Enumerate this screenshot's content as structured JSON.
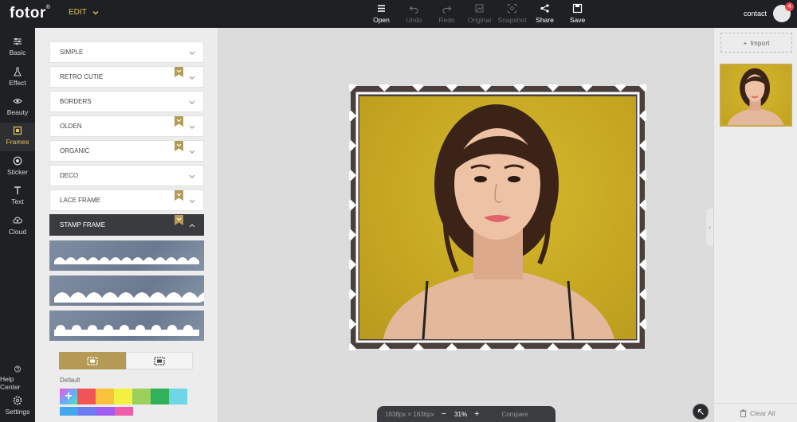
{
  "app": {
    "logo": "fotor",
    "logo_mark": "®",
    "edit_label": "EDIT"
  },
  "toolbar": [
    {
      "label": "Open",
      "icon": "menu-icon",
      "enabled": true
    },
    {
      "label": "Undo",
      "icon": "undo-icon",
      "enabled": false
    },
    {
      "label": "Redo",
      "icon": "redo-icon",
      "enabled": false
    },
    {
      "label": "Original",
      "icon": "original-icon",
      "enabled": false
    },
    {
      "label": "Snapshot",
      "icon": "snapshot-icon",
      "enabled": false
    },
    {
      "label": "Share",
      "icon": "share-icon",
      "enabled": true
    },
    {
      "label": "Save",
      "icon": "save-icon",
      "enabled": true
    }
  ],
  "account": {
    "label": "contact",
    "notifications": "4"
  },
  "nav": [
    {
      "label": "Basic",
      "icon": "sliders-icon"
    },
    {
      "label": "Effect",
      "icon": "flask-icon"
    },
    {
      "label": "Beauty",
      "icon": "eye-icon"
    },
    {
      "label": "Frames",
      "icon": "frame-icon",
      "active": true
    },
    {
      "label": "Sticker",
      "icon": "sticker-icon"
    },
    {
      "label": "Text",
      "icon": "text-icon"
    },
    {
      "label": "Cloud",
      "icon": "cloud-icon"
    },
    {
      "label": "Help Center",
      "icon": "help-icon"
    },
    {
      "label": "Settings",
      "icon": "settings-icon"
    }
  ],
  "frames": {
    "categories": [
      {
        "label": "SIMPLE",
        "premium": false
      },
      {
        "label": "RETRO CUTIE",
        "premium": true
      },
      {
        "label": "BORDERS",
        "premium": false
      },
      {
        "label": "OLDEN",
        "premium": true
      },
      {
        "label": "ORGANIC",
        "premium": true
      },
      {
        "label": "DECO",
        "premium": false
      },
      {
        "label": "LACE FRAME",
        "premium": true
      },
      {
        "label": "STAMP FRAME",
        "premium": true,
        "expanded": true
      }
    ],
    "stamp_styles": [
      "stamp-scallop-1",
      "stamp-scallop-2",
      "stamp-scallop-3"
    ],
    "default_label": "Default",
    "colors_row1": [
      "#f05454",
      "#f8c33a",
      "#f4f042",
      "#9bd05a",
      "#31b15a",
      "#6fd6e8"
    ],
    "colors_row2": [
      "#43a6ef",
      "#6d7cf0",
      "#a25cf0",
      "#ef5ca9"
    ],
    "toggle_active_color": "#b59a55"
  },
  "right_panel": {
    "import_label": "Import",
    "clear_label": "Clear All"
  },
  "zoom": {
    "dimensions": "1838px × 1636px",
    "minus": "−",
    "percent": "31%",
    "plus": "+",
    "compare": "Compare"
  },
  "accent": "#e2c15f"
}
